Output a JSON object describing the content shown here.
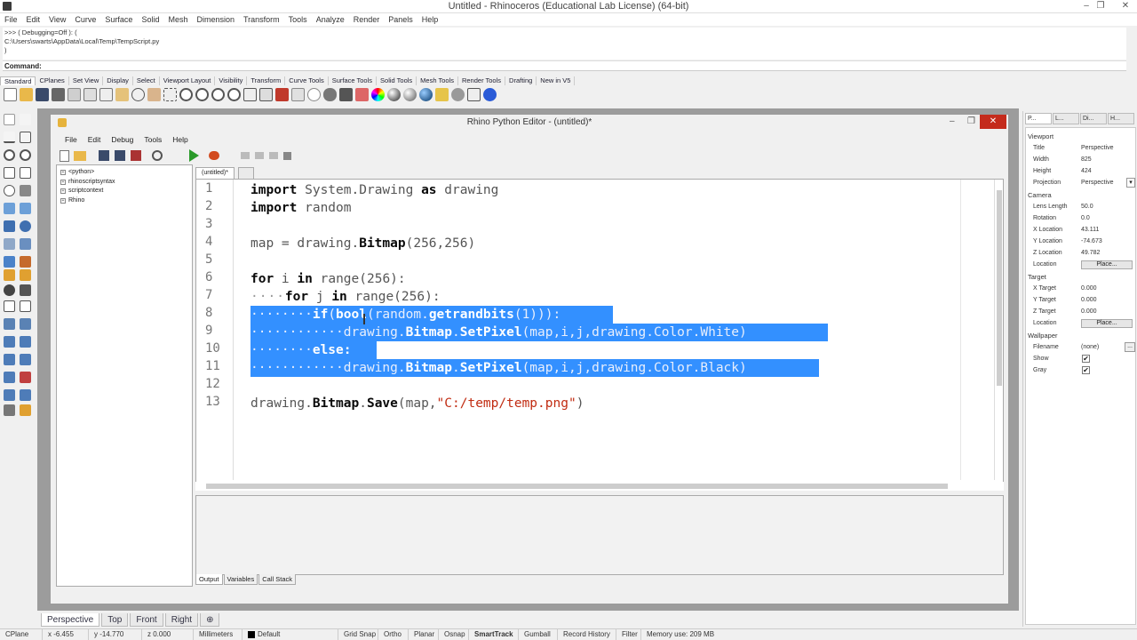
{
  "app": {
    "title": "Untitled - Rhinoceros (Educational Lab License) (64-bit)",
    "window_controls": {
      "min": "–",
      "max": "❐",
      "close": "✕"
    }
  },
  "menu": [
    "File",
    "Edit",
    "View",
    "Curve",
    "Surface",
    "Solid",
    "Mesh",
    "Dimension",
    "Transform",
    "Tools",
    "Analyze",
    "Render",
    "Panels",
    "Help"
  ],
  "command_history": ">>> ( Debugging=Off ): (\nC:\\Users\\swarts\\AppData\\Local\\Temp\\TempScript.py\n)",
  "command_label": "Command:",
  "toolbar_tabs": [
    "Standard",
    "CPlanes",
    "Set View",
    "Display",
    "Select",
    "Viewport Layout",
    "Visibility",
    "Transform",
    "Curve Tools",
    "Surface Tools",
    "Solid Tools",
    "Mesh Tools",
    "Render Tools",
    "Drafting",
    "New in V5"
  ],
  "python_editor": {
    "title": "Rhino Python Editor - (untitled)*",
    "menu": [
      "File",
      "Edit",
      "Debug",
      "Tools",
      "Help"
    ],
    "tree": [
      "<python>",
      "rhinoscriptsyntax",
      "scriptcontext",
      "Rhino"
    ],
    "tab_label": "(untitled)*",
    "line_numbers": [
      "1",
      "2",
      "3",
      "4",
      "5",
      "6",
      "7",
      "8",
      "9",
      "10",
      "11",
      "12",
      "13"
    ],
    "code": {
      "l1_kw1": "import",
      "l1_a": " System.Drawing ",
      "l1_kw2": "as",
      "l1_b": " drawing",
      "l2_kw": "import",
      "l2_a": " random",
      "l4": "map = drawing.",
      "l4_b": "Bitmap",
      "l4_c": "(256,256)",
      "l6_kw1": "for",
      "l6_a": " i ",
      "l6_kw2": "in",
      "l6_b": " range(256):",
      "l7_dots": "····",
      "l7_kw1": "for",
      "l7_a": " j ",
      "l7_kw2": "in",
      "l7_b": " range(256):",
      "l8_dots": "········",
      "l8_kw": "if",
      "l8_a": "(",
      "l8_b": "bool",
      "l8_c": "(random.",
      "l8_d": "getrandbits",
      "l8_e": "(1))):",
      "l9_dots": "············",
      "l9_a": "drawing.",
      "l9_b": "Bitmap",
      "l9_c": ".",
      "l9_d": "SetPixel",
      "l9_e": "(map,i,j,drawing.Color.White)",
      "l10_dots": "········",
      "l10_kw": "else:",
      "l11_dots": "············",
      "l11_a": "drawing.",
      "l11_b": "Bitmap",
      "l11_c": ".",
      "l11_d": "SetPixel",
      "l11_e": "(map,i,j,drawing.Color.Black)",
      "l13_a": "drawing.",
      "l13_b": "Bitmap",
      "l13_c": ".",
      "l13_d": "Save",
      "l13_e": "(map,",
      "l13_str": "\"C:/temp/temp.png\"",
      "l13_f": ")"
    },
    "output_tabs": [
      "Output",
      "Variables",
      "Call Stack"
    ]
  },
  "viewport_tabs": [
    "Perspective",
    "Top",
    "Front",
    "Right",
    "⊕"
  ],
  "status": {
    "cplane": "CPlane",
    "x": "x -6.455",
    "y": "y -14.770",
    "z": "z 0.000",
    "units": "Millimeters",
    "layer": "Default",
    "toggles": [
      "Grid Snap",
      "Ortho",
      "Planar",
      "Osnap",
      "SmartTrack",
      "Gumball",
      "Record History",
      "Filter"
    ],
    "memory": "Memory use: 209 MB"
  },
  "properties": {
    "tabs": [
      "P...",
      "L...",
      "Di...",
      "H..."
    ],
    "viewport_header": "Viewport",
    "title_label": "Title",
    "title_value": "Perspective",
    "width_label": "Width",
    "width_value": "825",
    "height_label": "Height",
    "height_value": "424",
    "projection_label": "Projection",
    "projection_value": "Perspective",
    "camera_header": "Camera",
    "lens_label": "Lens Length",
    "lens_value": "50.0",
    "rotation_label": "Rotation",
    "rotation_value": "0.0",
    "xloc_label": "X Location",
    "xloc_value": "43.111",
    "yloc_label": "Y Location",
    "yloc_value": "-74.673",
    "zloc_label": "Z Location",
    "zloc_value": "49.782",
    "location_label": "Location",
    "place_button": "Place...",
    "target_header": "Target",
    "xt_label": "X Target",
    "xt_value": "0.000",
    "yt_label": "Y Target",
    "yt_value": "0.000",
    "zt_label": "Z Target",
    "zt_value": "0.000",
    "tloc_label": "Location",
    "tplace_button": "Place...",
    "wallpaper_header": "Wallpaper",
    "filename_label": "Filename",
    "filename_value": "(none)",
    "show_label": "Show",
    "gray_label": "Gray",
    "check": "✔",
    "browse_button": "..."
  },
  "colors": {
    "selection": "#3390ff",
    "accent": "#0078d7"
  }
}
